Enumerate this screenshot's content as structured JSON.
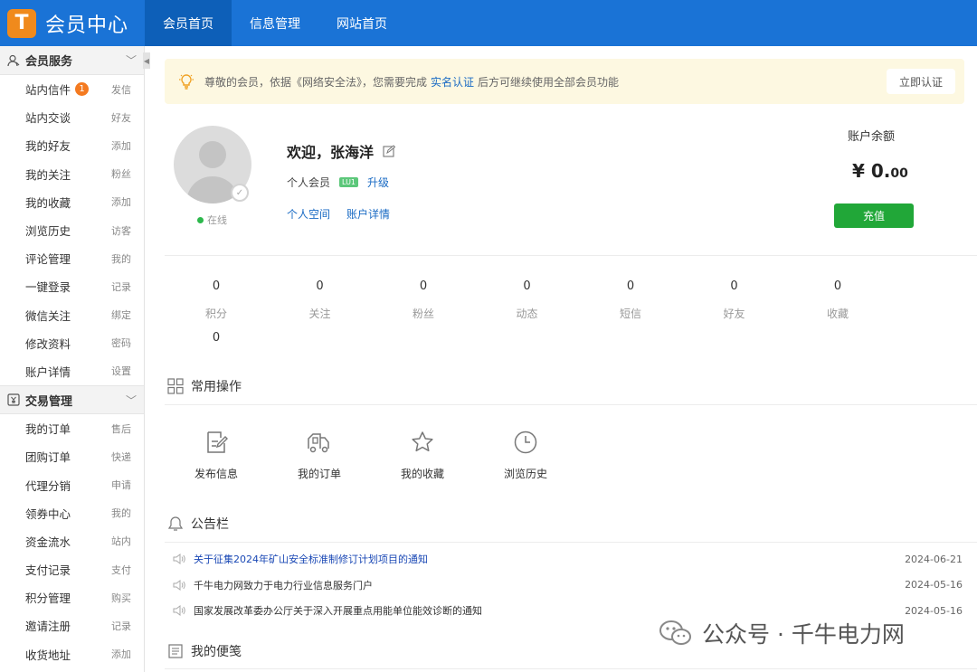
{
  "app": {
    "logo_letter": "T",
    "title": "会员中心"
  },
  "nav": [
    {
      "label": "会员首页",
      "active": true
    },
    {
      "label": "信息管理",
      "active": false
    },
    {
      "label": "网站首页",
      "active": false
    }
  ],
  "sidebar": {
    "group1": {
      "title": "会员服务",
      "items": [
        {
          "label": "站内信件",
          "badge": "1",
          "sub": "发信"
        },
        {
          "label": "站内交谈",
          "sub": "好友"
        },
        {
          "label": "我的好友",
          "sub": "添加"
        },
        {
          "label": "我的关注",
          "sub": "粉丝"
        },
        {
          "label": "我的收藏",
          "sub": "添加"
        },
        {
          "label": "浏览历史",
          "sub": "访客"
        },
        {
          "label": "评论管理",
          "sub": "我的"
        },
        {
          "label": "一键登录",
          "sub": "记录"
        },
        {
          "label": "微信关注",
          "sub": "绑定"
        },
        {
          "label": "修改资料",
          "sub": "密码"
        },
        {
          "label": "账户详情",
          "sub": "设置"
        }
      ]
    },
    "group2": {
      "title": "交易管理",
      "items": [
        {
          "label": "我的订单",
          "sub": "售后"
        },
        {
          "label": "团购订单",
          "sub": "快递"
        },
        {
          "label": "代理分销",
          "sub": "申请"
        },
        {
          "label": "领券中心",
          "sub": "我的"
        },
        {
          "label": "资金流水",
          "sub": "站内"
        },
        {
          "label": "支付记录",
          "sub": "支付"
        },
        {
          "label": "积分管理",
          "sub": "购买"
        },
        {
          "label": "邀请注册",
          "sub": "记录"
        },
        {
          "label": "收货地址",
          "sub": "添加"
        }
      ]
    }
  },
  "notice": {
    "prefix": "尊敬的会员，依据《网络安全法》，您需要完成",
    "link": "实名认证",
    "suffix": "后方可继续使用全部会员功能",
    "button": "立即认证"
  },
  "profile": {
    "status": "在线",
    "welcome": "欢迎，张海洋",
    "member_type": "个人会员",
    "level_badge": "LU1",
    "upgrade": "升级",
    "space_link": "个人空间",
    "account_link": "账户详情",
    "balance_label": "账户余额",
    "balance_int": "¥ 0.",
    "balance_dec": "00",
    "recharge": "充值"
  },
  "stats": [
    {
      "value": "0",
      "label": "积分"
    },
    {
      "value": "0",
      "label": "关注"
    },
    {
      "value": "0",
      "label": "粉丝"
    },
    {
      "value": "0",
      "label": "动态"
    },
    {
      "value": "0",
      "label": "短信"
    },
    {
      "value": "0",
      "label": "好友"
    },
    {
      "value": "0",
      "label": "收藏"
    },
    {
      "value": "0",
      "label": ""
    }
  ],
  "common_ops": {
    "title": "常用操作",
    "items": [
      {
        "label": "发布信息",
        "icon": "edit-icon"
      },
      {
        "label": "我的订单",
        "icon": "truck-icon"
      },
      {
        "label": "我的收藏",
        "icon": "star-icon"
      },
      {
        "label": "浏览历史",
        "icon": "clock-icon"
      }
    ]
  },
  "bulletin": {
    "title": "公告栏",
    "items": [
      {
        "text": "关于征集2024年矿山安全标准制修订计划项目的通知",
        "date": "2024-06-21"
      },
      {
        "text": "千牛电力网致力于电力行业信息服务门户",
        "date": "2024-05-16"
      },
      {
        "text": "国家发展改革委办公厅关于深入开展重点用能单位能效诊断的通知",
        "date": "2024-05-16"
      }
    ]
  },
  "notes": {
    "title": "我的便笺"
  },
  "watermark": {
    "text": "公众号 · 千牛电力网"
  },
  "colors": {
    "primary": "#1a73d6",
    "active_nav": "#0d5fb8",
    "accent": "#f08a1c",
    "success": "#21a738",
    "link": "#1a6bc4"
  }
}
